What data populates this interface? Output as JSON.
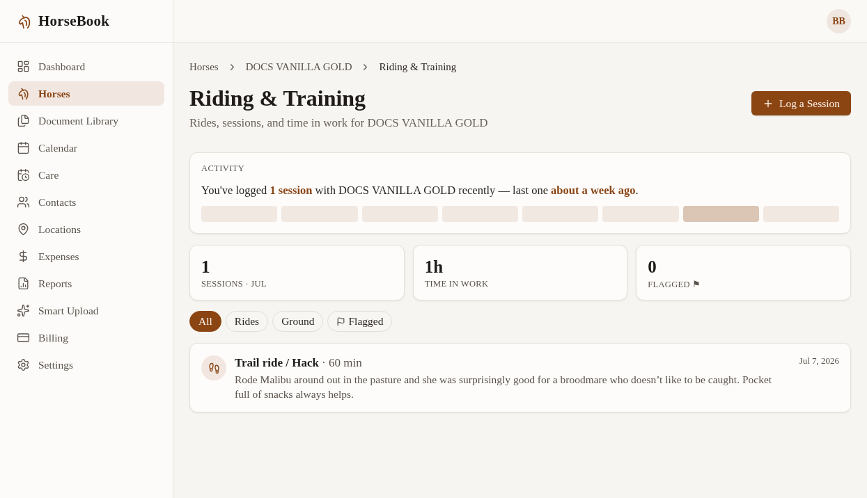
{
  "sidebar": {
    "brand": "HorseBook",
    "items": [
      {
        "label": "Dashboard",
        "selected": false
      },
      {
        "label": "Horses",
        "selected": true
      },
      {
        "label": "Document Library",
        "selected": false
      },
      {
        "label": "Calendar",
        "selected": false
      },
      {
        "label": "Care",
        "selected": false
      },
      {
        "label": "Contacts",
        "selected": false
      },
      {
        "label": "Locations",
        "selected": false
      },
      {
        "label": "Expenses",
        "selected": false
      },
      {
        "label": "Reports",
        "selected": false
      },
      {
        "label": "Smart Upload",
        "selected": false
      },
      {
        "label": "Billing",
        "selected": false
      },
      {
        "label": "Settings",
        "selected": false
      }
    ]
  },
  "header": {
    "avatar": "BB"
  },
  "breadcrumb": [
    "Horses",
    "DOCS VANILLA GOLD",
    "Riding & Training"
  ],
  "page": {
    "title": "Riding & Training",
    "subtitle": "Rides, sessions, and time in work for DOCS VANILLA GOLD",
    "action": "Log a Session"
  },
  "activity": {
    "heading": "ACTIVITY",
    "summary": "You've logged **1 session** with DOCS VANILLA GOLD recently — last one **about a week ago**.",
    "bars": [
      {
        "active": false
      },
      {
        "active": false
      },
      {
        "active": false
      },
      {
        "active": false
      },
      {
        "active": false
      },
      {
        "active": false
      },
      {
        "active": true
      },
      {
        "active": false
      }
    ]
  },
  "stats": [
    {
      "value": "1",
      "label": "SESSIONS · JUL"
    },
    {
      "value": "1h",
      "label": "TIME IN WORK"
    },
    {
      "value": "0",
      "label": "FLAGGED ⚑"
    }
  ],
  "filters": [
    {
      "label": "All",
      "selected": true
    },
    {
      "label": "Rides",
      "selected": false
    },
    {
      "label": "Ground",
      "selected": false
    },
    {
      "label": "Flagged",
      "selected": false
    }
  ],
  "sessions": [
    {
      "title": "Trail ride / Hack",
      "duration": "· 60 min",
      "notes": "Rode Malibu around out in the pasture and she was surprisingly good for a broodmare who doesn’t like to be caught. Pocket full of snacks always helps.",
      "date": "Jul 7, 2026"
    }
  ]
}
